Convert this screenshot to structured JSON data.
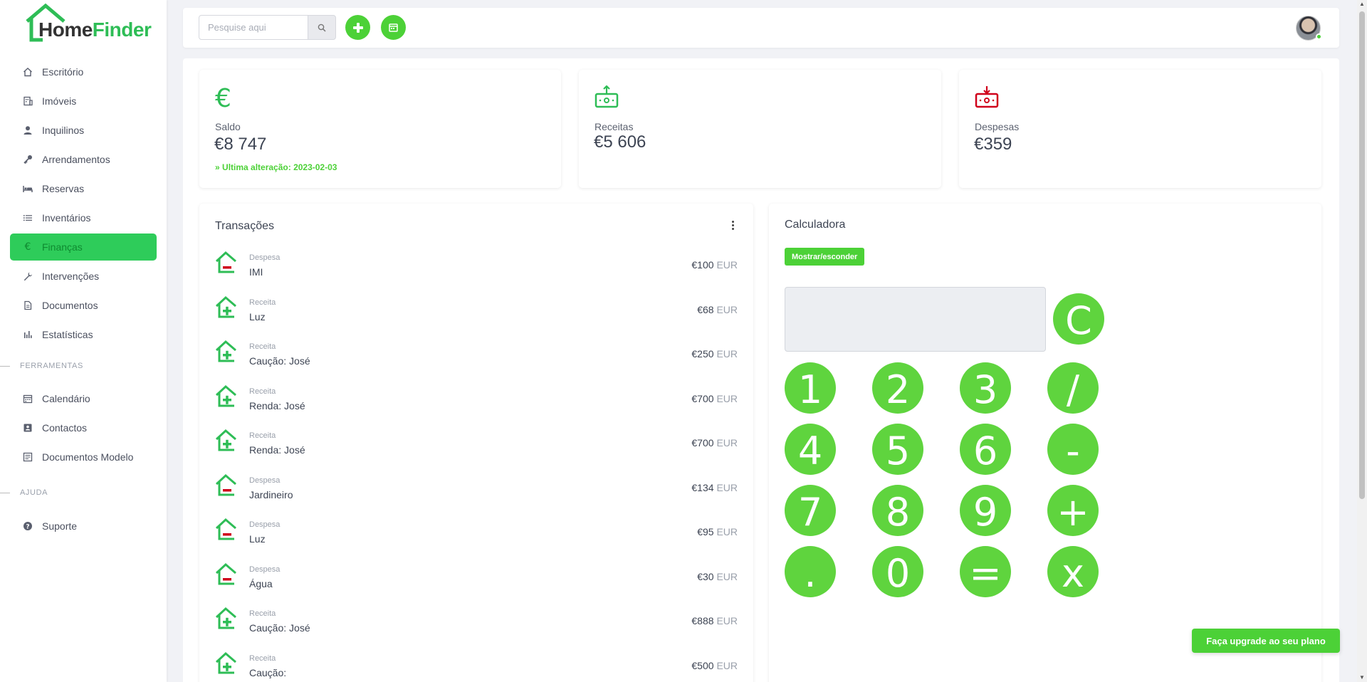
{
  "brand": {
    "part1": "Home",
    "part2": "Finder"
  },
  "sidebar": {
    "items": [
      {
        "label": "Escritório",
        "icon": "home-icon"
      },
      {
        "label": "Imóveis",
        "icon": "building-icon"
      },
      {
        "label": "Inquilinos",
        "icon": "user-icon"
      },
      {
        "label": "Arrendamentos",
        "icon": "key-icon"
      },
      {
        "label": "Reservas",
        "icon": "bed-icon"
      },
      {
        "label": "Inventários",
        "icon": "list-icon"
      },
      {
        "label": "Finanças",
        "icon": "euro-icon",
        "active": true
      },
      {
        "label": "Intervenções",
        "icon": "wrench-icon"
      },
      {
        "label": "Documentos",
        "icon": "document-icon"
      },
      {
        "label": "Estatísticas",
        "icon": "bar-chart-icon"
      }
    ],
    "tools_label": "FERRAMENTAS",
    "tools": [
      {
        "label": "Calendário",
        "icon": "calendar-icon"
      },
      {
        "label": "Contactos",
        "icon": "contact-card-icon"
      },
      {
        "label": "Documentos Modelo",
        "icon": "template-icon"
      }
    ],
    "help_label": "AJUDA",
    "help": [
      {
        "label": "Suporte",
        "icon": "question-icon"
      }
    ]
  },
  "topbar": {
    "search_placeholder": "Pesquise aqui"
  },
  "stats": {
    "saldo": {
      "label": "Saldo",
      "value": "€8 747",
      "note": "Ultima alteração: 2023-02-03"
    },
    "receitas": {
      "label": "Receitas",
      "value": "€5 606"
    },
    "despesas": {
      "label": "Despesas",
      "value": "€359"
    }
  },
  "transactions": {
    "title": "Transações",
    "currency": "EUR",
    "rows": [
      {
        "type": "Despesa",
        "name": "IMI",
        "amount": "€100"
      },
      {
        "type": "Receita",
        "name": "Luz",
        "amount": "€68"
      },
      {
        "type": "Receita",
        "name": "Caução: José",
        "amount": "€250"
      },
      {
        "type": "Receita",
        "name": "Renda: José",
        "amount": "€700"
      },
      {
        "type": "Receita",
        "name": "Renda: José",
        "amount": "€700"
      },
      {
        "type": "Despesa",
        "name": "Jardineiro",
        "amount": "€134"
      },
      {
        "type": "Despesa",
        "name": "Luz",
        "amount": "€95"
      },
      {
        "type": "Despesa",
        "name": "Água",
        "amount": "€30"
      },
      {
        "type": "Receita",
        "name": "Caução: José",
        "amount": "€888"
      },
      {
        "type": "Receita",
        "name": "Caução:",
        "amount": "€500"
      }
    ]
  },
  "calculator": {
    "title": "Calculadora",
    "toggle_label": "Mostrar/esconder",
    "display": "",
    "clear_key": "C",
    "keys": [
      "1",
      "2",
      "3",
      "/",
      "4",
      "5",
      "6",
      "-",
      "7",
      "8",
      "9",
      "+",
      ".",
      "0",
      "=",
      "x"
    ]
  },
  "upgrade_label": "Faça upgrade ao seu plano",
  "colors": {
    "accent": "#4cd137",
    "active_nav": "#2ecc5a",
    "expense": "#d0021b"
  }
}
